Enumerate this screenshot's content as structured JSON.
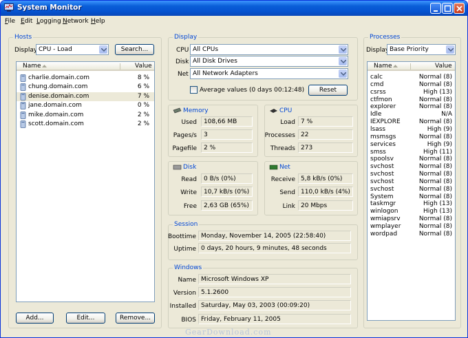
{
  "window": {
    "title": "System Monitor"
  },
  "menu": [
    "File",
    "Edit",
    "Logging",
    "Network",
    "Help"
  ],
  "hosts": {
    "group_title": "Hosts",
    "display_label": "Display",
    "display_value": "CPU - Load",
    "search_label": "Search...",
    "columns": {
      "name": "Name",
      "value": "Value"
    },
    "rows": [
      {
        "name": "charlie.domain.com",
        "value": "8 %"
      },
      {
        "name": "chung.domain.com",
        "value": "6 %"
      },
      {
        "name": "denise.domain.com",
        "value": "7 %"
      },
      {
        "name": "jane.domain.com",
        "value": "0 %"
      },
      {
        "name": "mike.domain.com",
        "value": "2 %"
      },
      {
        "name": "scott.domain.com",
        "value": "2 %"
      }
    ],
    "selected_index": 2,
    "add_label": "Add...",
    "edit_label": "Edit...",
    "remove_label": "Remove..."
  },
  "display": {
    "group_title": "Display",
    "cpu_label": "CPU",
    "cpu_value": "All CPUs",
    "disk_label": "Disk",
    "disk_value": "All Disk Drives",
    "net_label": "Net",
    "net_value": "All Network Adapters",
    "average_label": "Average values (0 days 00:12:48)",
    "average_checked": false,
    "reset_label": "Reset"
  },
  "memory": {
    "title": "Memory",
    "used_label": "Used",
    "used_value": "108,66 MB",
    "pages_label": "Pages/s",
    "pages_value": "3",
    "pagefile_label": "Pagefile",
    "pagefile_value": "2 %"
  },
  "cpu": {
    "title": "CPU",
    "load_label": "Load",
    "load_value": "7 %",
    "processes_label": "Processes",
    "processes_value": "22",
    "threads_label": "Threads",
    "threads_value": "273"
  },
  "disk": {
    "title": "Disk",
    "read_label": "Read",
    "read_value": "0 B/s (0%)",
    "write_label": "Write",
    "write_value": "10,7 kB/s (0%)",
    "free_label": "Free",
    "free_value": "2,63 GB (65%)"
  },
  "net": {
    "title": "Net",
    "receive_label": "Receive",
    "receive_value": "5,8 kB/s (0%)",
    "send_label": "Send",
    "send_value": "110,0 kB/s (4%)",
    "link_label": "Link",
    "link_value": "20 Mbps"
  },
  "session": {
    "group_title": "Session",
    "boottime_label": "Boottime",
    "boottime_value": "Monday, November 14, 2005 (22:58:40)",
    "uptime_label": "Uptime",
    "uptime_value": "0 days, 20 hours, 9 minutes, 48 seconds"
  },
  "windows": {
    "group_title": "Windows",
    "name_label": "Name",
    "name_value": "Microsoft Windows XP",
    "version_label": "Version",
    "version_value": "5.1.2600",
    "installed_label": "Installed",
    "installed_value": "Saturday, May 03, 2003 (00:09:20)",
    "bios_label": "BIOS",
    "bios_value": "Friday, February 11, 2005"
  },
  "processes": {
    "group_title": "Processes",
    "display_label": "Display",
    "display_value": "Base Priority",
    "columns": {
      "name": "Name",
      "value": "Value"
    },
    "rows": [
      {
        "name": "calc",
        "value": "Normal (8)"
      },
      {
        "name": "cmd",
        "value": "Normal (8)"
      },
      {
        "name": "csrss",
        "value": "High (13)"
      },
      {
        "name": "ctfmon",
        "value": "Normal (8)"
      },
      {
        "name": "explorer",
        "value": "Normal (8)"
      },
      {
        "name": "Idle",
        "value": "N/A"
      },
      {
        "name": "IEXPLORE",
        "value": "Normal (8)"
      },
      {
        "name": "lsass",
        "value": "High (9)"
      },
      {
        "name": "msmsgs",
        "value": "Normal (8)"
      },
      {
        "name": "services",
        "value": "High (9)"
      },
      {
        "name": "smss",
        "value": "High (11)"
      },
      {
        "name": "spoolsv",
        "value": "Normal (8)"
      },
      {
        "name": "svchost",
        "value": "Normal (8)"
      },
      {
        "name": "svchost",
        "value": "Normal (8)"
      },
      {
        "name": "svchost",
        "value": "Normal (8)"
      },
      {
        "name": "svchost",
        "value": "Normal (8)"
      },
      {
        "name": "System",
        "value": "Normal (8)"
      },
      {
        "name": "taskmgr",
        "value": "High (13)"
      },
      {
        "name": "winlogon",
        "value": "High (13)"
      },
      {
        "name": "wmiapsrv",
        "value": "Normal (8)"
      },
      {
        "name": "wmplayer",
        "value": "Normal (8)"
      },
      {
        "name": "wordpad",
        "value": "Normal (8)"
      }
    ]
  },
  "watermark": "GearDownload.com",
  "colors": {
    "group_title": "#0046d5",
    "titlebar": "#0553d1",
    "window_bg": "#ece9d8"
  }
}
